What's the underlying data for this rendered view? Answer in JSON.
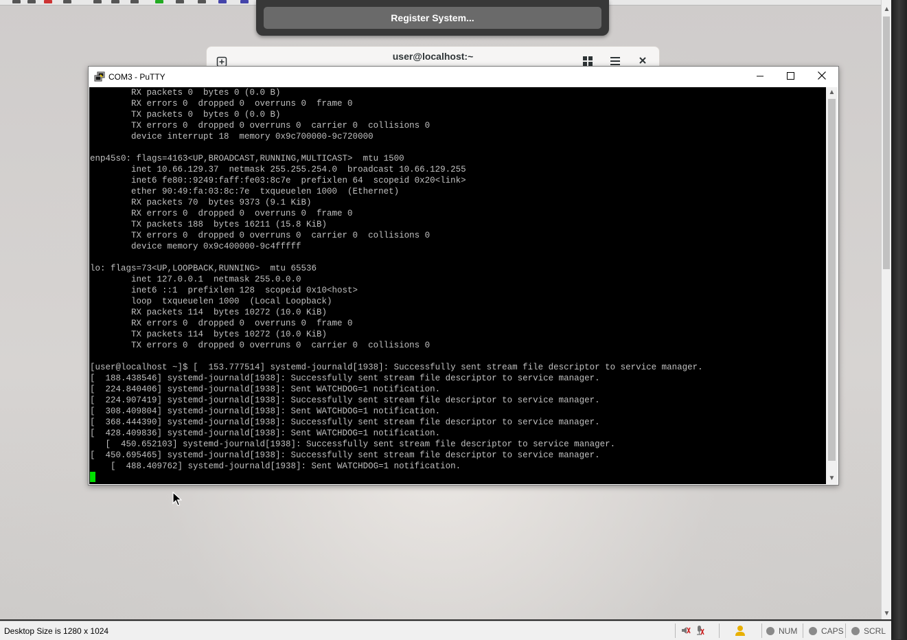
{
  "gnome": {
    "register_label": "Register System...",
    "terminal_title": "user@localhost:~"
  },
  "putty": {
    "title": "COM3 - PuTTY",
    "terminal_lines": [
      "        RX packets 0  bytes 0 (0.0 B)",
      "        RX errors 0  dropped 0  overruns 0  frame 0",
      "        TX packets 0  bytes 0 (0.0 B)",
      "        TX errors 0  dropped 0 overruns 0  carrier 0  collisions 0",
      "        device interrupt 18  memory 0x9c700000-9c720000",
      "",
      "enp45s0: flags=4163<UP,BROADCAST,RUNNING,MULTICAST>  mtu 1500",
      "        inet 10.66.129.37  netmask 255.255.254.0  broadcast 10.66.129.255",
      "        inet6 fe80::9249:faff:fe03:8c7e  prefixlen 64  scopeid 0x20<link>",
      "        ether 90:49:fa:03:8c:7e  txqueuelen 1000  (Ethernet)",
      "        RX packets 70  bytes 9373 (9.1 KiB)",
      "        RX errors 0  dropped 0  overruns 0  frame 0",
      "        TX packets 188  bytes 16211 (15.8 KiB)",
      "        TX errors 0  dropped 0 overruns 0  carrier 0  collisions 0",
      "        device memory 0x9c400000-9c4fffff",
      "",
      "lo: flags=73<UP,LOOPBACK,RUNNING>  mtu 65536",
      "        inet 127.0.0.1  netmask 255.0.0.0",
      "        inet6 ::1  prefixlen 128  scopeid 0x10<host>",
      "        loop  txqueuelen 1000  (Local Loopback)",
      "        RX packets 114  bytes 10272 (10.0 KiB)",
      "        RX errors 0  dropped 0  overruns 0  frame 0",
      "        TX packets 114  bytes 10272 (10.0 KiB)",
      "        TX errors 0  dropped 0 overruns 0  carrier 0  collisions 0",
      "",
      "[user@localhost ~]$ [  153.777514] systemd-journald[1938]: Successfully sent stream file descriptor to service manager.",
      "[  188.438546] systemd-journald[1938]: Successfully sent stream file descriptor to service manager.",
      "[  224.840406] systemd-journald[1938]: Sent WATCHDOG=1 notification.",
      "[  224.907419] systemd-journald[1938]: Successfully sent stream file descriptor to service manager.",
      "[  308.409804] systemd-journald[1938]: Sent WATCHDOG=1 notification.",
      "[  368.444390] systemd-journald[1938]: Successfully sent stream file descriptor to service manager.",
      "[  428.409836] systemd-journald[1938]: Sent WATCHDOG=1 notification.",
      "   [  450.652103] systemd-journald[1938]: Successfully sent stream file descriptor to service manager.",
      "[  450.695465] systemd-journald[1938]: Successfully sent stream file descriptor to service manager.",
      "    [  488.409762] systemd-journald[1938]: Sent WATCHDOG=1 notification."
    ]
  },
  "statusbar": {
    "desktop_size": "Desktop Size is 1280 x 1024",
    "num": "NUM",
    "caps": "CAPS",
    "scrl": "SCRL"
  },
  "colors": {
    "terminal_bg": "#000000",
    "terminal_fg": "#c0c0c0",
    "cursor": "#00e000",
    "popup_bg": "#383838"
  }
}
